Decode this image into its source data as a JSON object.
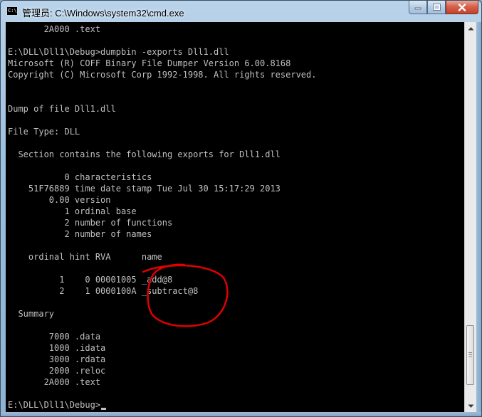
{
  "window": {
    "title": "管理员: C:\\Windows\\system32\\cmd.exe",
    "icon_text": "C:\\"
  },
  "console": {
    "lines": [
      "       2A000 .text",
      "",
      "E:\\DLL\\Dll1\\Debug>dumpbin -exports Dll1.dll",
      "Microsoft (R) COFF Binary File Dumper Version 6.00.8168",
      "Copyright (C) Microsoft Corp 1992-1998. All rights reserved.",
      "",
      "",
      "Dump of file Dll1.dll",
      "",
      "File Type: DLL",
      "",
      "  Section contains the following exports for Dll1.dll",
      "",
      "           0 characteristics",
      "    51F76889 time date stamp Tue Jul 30 15:17:29 2013",
      "        0.00 version",
      "           1 ordinal base",
      "           2 number of functions",
      "           2 number of names",
      "",
      "    ordinal hint RVA      name",
      "",
      "          1    0 00001005 _add@8",
      "          2    1 0000100A _subtract@8",
      "",
      "  Summary",
      "",
      "        7000 .data",
      "        1000 .idata",
      "        3000 .rdata",
      "        2000 .reloc",
      "       2A000 .text",
      "",
      "E:\\DLL\\Dll1\\Debug>"
    ]
  },
  "colors": {
    "console_bg": "#000000",
    "console_fg": "#c0c0c0",
    "annotation": "#e00000"
  },
  "icons": [
    "cmd-app-icon",
    "minimize-icon",
    "maximize-icon",
    "close-icon",
    "scroll-up-icon",
    "scroll-down-icon"
  ]
}
